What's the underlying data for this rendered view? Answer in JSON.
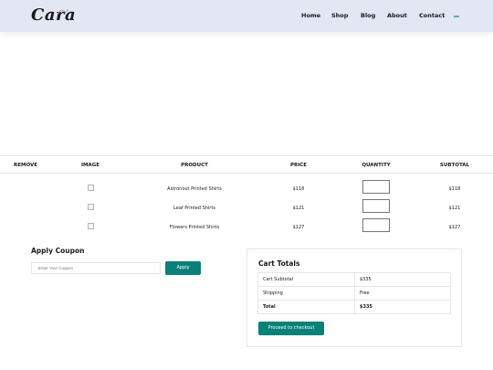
{
  "header": {
    "logo": "Cara",
    "nav": [
      "Home",
      "Shop",
      "Blog",
      "About",
      "Contact"
    ]
  },
  "cart": {
    "columns": [
      "REMOVE",
      "IMAGE",
      "PRODUCT",
      "PRICE",
      "QUANTITY",
      "SUBTOTAL"
    ],
    "rows": [
      {
        "product": "Astronout Printed Shirts",
        "price": "$118",
        "quantity": "",
        "subtotal": "$118"
      },
      {
        "product": "Leaf Printed Shirts",
        "price": "$121",
        "quantity": "",
        "subtotal": "$121"
      },
      {
        "product": "Flowers Printed Shirts",
        "price": "$127",
        "quantity": "",
        "subtotal": "$127"
      }
    ]
  },
  "coupon": {
    "title": "Apply Coupon",
    "placeholder": "Enter Your Coupon",
    "button": "Apply"
  },
  "totals": {
    "title": "Cart Totals",
    "rows": [
      {
        "label": "Cart Subtotal",
        "value": "$335"
      },
      {
        "label": "Shipping",
        "value": "Free"
      },
      {
        "label": "Total",
        "value": "$335"
      }
    ],
    "checkout_button": "Proceed to checkout"
  },
  "colors": {
    "accent": "#088178",
    "header_bg": "#e3e6f3",
    "border": "#e2e9e1"
  }
}
